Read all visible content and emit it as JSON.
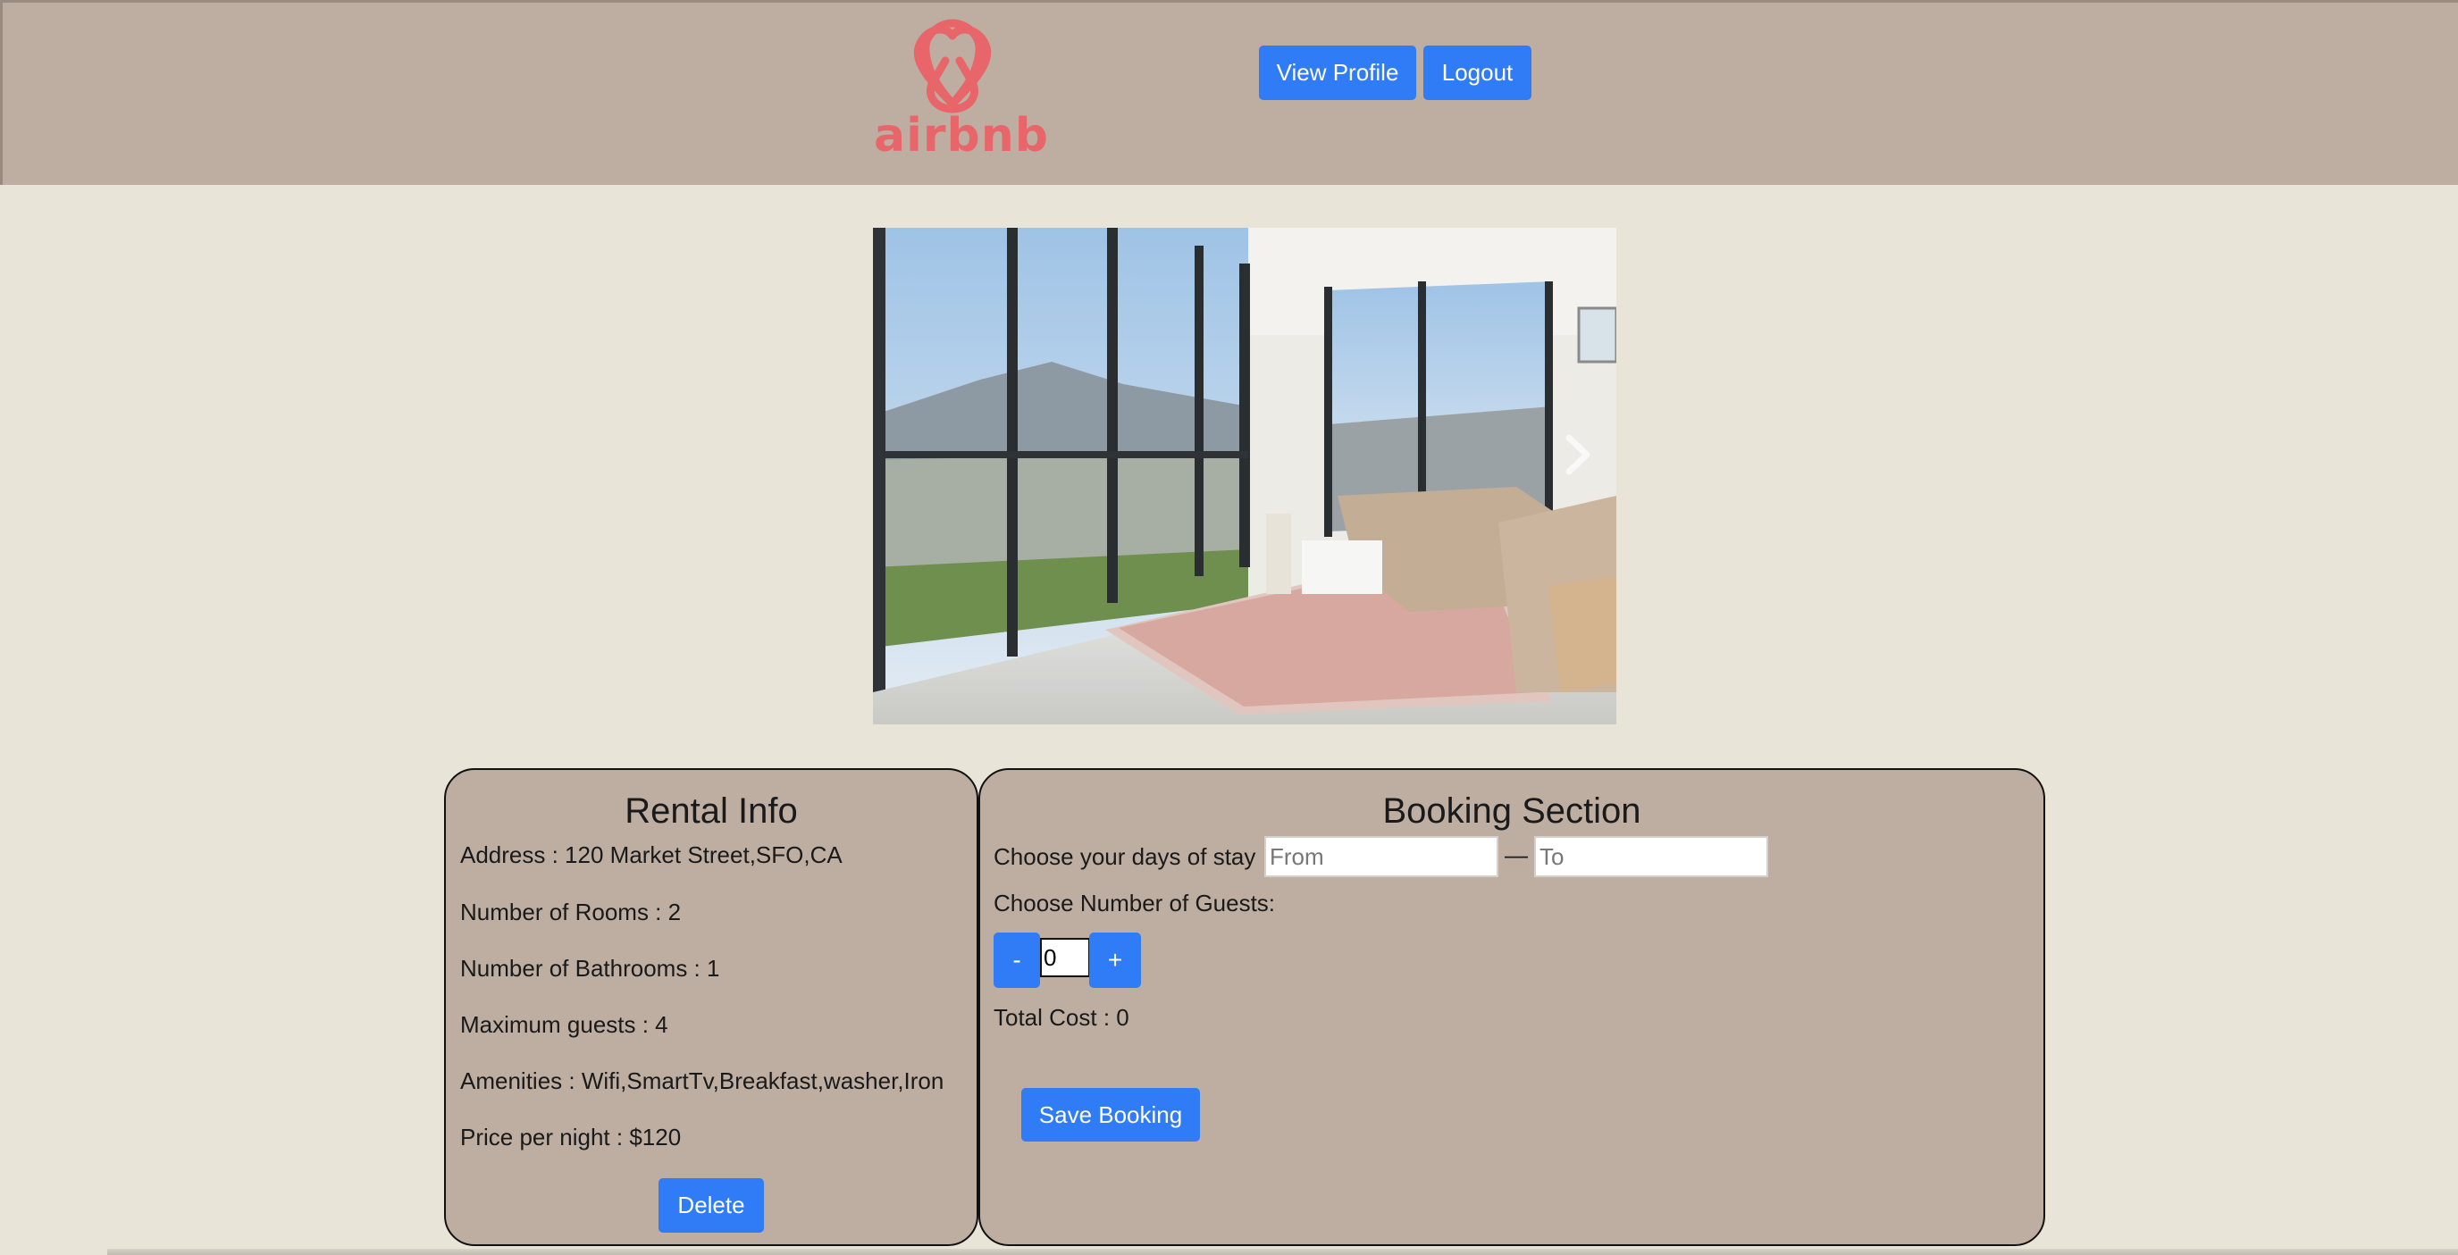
{
  "header": {
    "logo_text": "airbnb",
    "view_profile_label": "View Profile",
    "logout_label": "Logout"
  },
  "rental_info": {
    "title": "Rental Info",
    "address": "Address : 120 Market Street,SFO,CA",
    "rooms": "Number of Rooms : 2",
    "bathrooms": "Number of Bathrooms : 1",
    "max_guests": "Maximum guests : 4",
    "amenities": "Amenities : Wifi,SmartTv,Breakfast,washer,Iron",
    "price": "Price per night : $120",
    "delete_label": "Delete"
  },
  "booking": {
    "title": "Booking Section",
    "days_label": "Choose your days of stay :",
    "from_placeholder": "From",
    "to_placeholder": "To",
    "dash": "—",
    "guests_label": "Choose Number of Guests:",
    "minus_label": "-",
    "plus_label": "+",
    "guests_value": "0",
    "total_cost": "Total Cost : 0",
    "save_label": "Save Booking"
  },
  "colors": {
    "header_bg": "#beaea2",
    "page_bg": "#e8e4d8",
    "button_blue": "#2f7cf6",
    "logo_red": "#e8666a"
  },
  "icons": {
    "logo": "airbnb-belo-icon",
    "carousel_next": "chevron-right-icon"
  }
}
